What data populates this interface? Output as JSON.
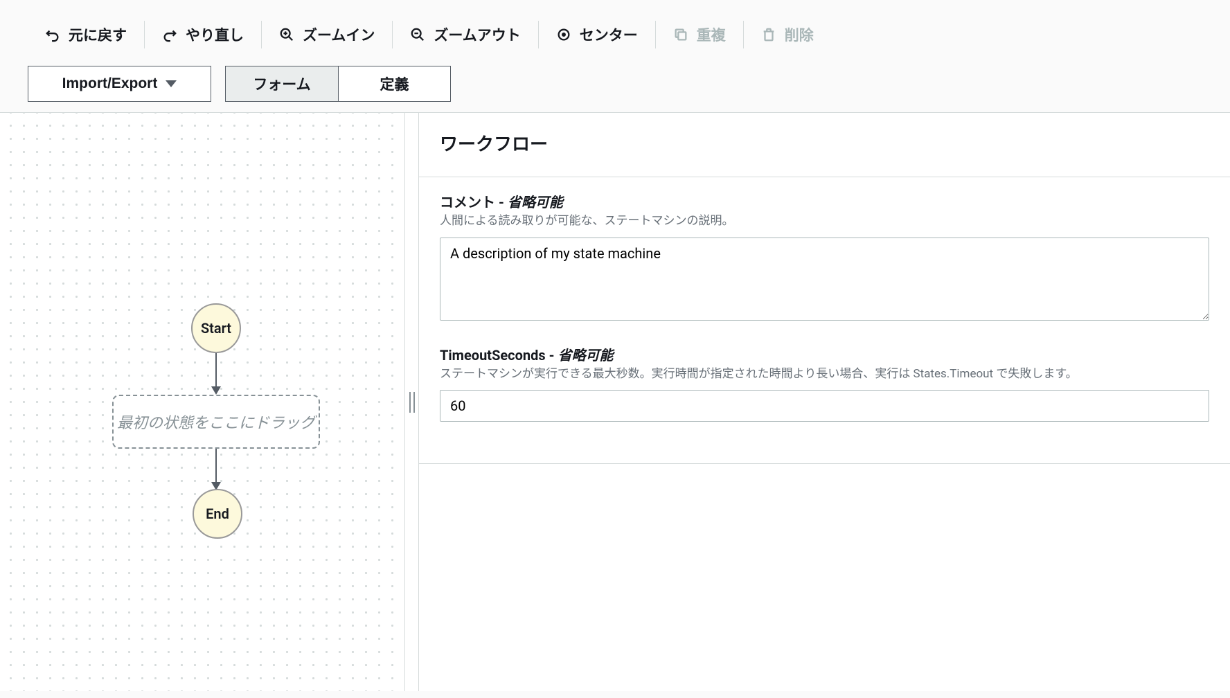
{
  "toolbar": {
    "undo": "元に戻す",
    "redo": "やり直し",
    "zoomIn": "ズームイン",
    "zoomOut": "ズームアウト",
    "center": "センター",
    "duplicate": "重複",
    "delete": "削除",
    "importExport": "Import/Export"
  },
  "tabs": {
    "form": "フォーム",
    "definition": "定義"
  },
  "canvas": {
    "start": "Start",
    "end": "End",
    "dropZone": "最初の状態をここにドラッグ"
  },
  "form": {
    "header": "ワークフロー",
    "comment": {
      "label": "コメント",
      "optional": "省略可能",
      "description": "人間による読み取りが可能な、ステートマシンの説明。",
      "value": "A description of my state machine"
    },
    "timeout": {
      "label": "TimeoutSeconds",
      "optional": "省略可能",
      "description": "ステートマシンが実行できる最大秒数。実行時間が指定された時間より長い場合、実行は States.Timeout で失敗します。",
      "value": "60"
    }
  }
}
